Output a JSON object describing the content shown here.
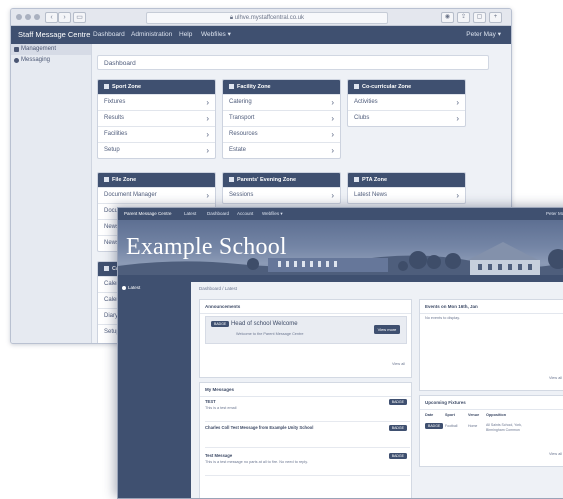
{
  "browser": {
    "url": "ulhve.mystaffcentral.co.uk"
  },
  "back_app": {
    "brand": "Staff Message Centre",
    "nav": [
      "Dashboard",
      "Administration",
      "Help",
      "Webfiles ▾"
    ],
    "user": "Peter May ▾",
    "sidebar": [
      {
        "label": "Management",
        "icon": "management-icon"
      },
      {
        "label": "Messaging",
        "icon": "messaging-icon"
      }
    ],
    "breadcrumb": "Dashboard",
    "zones": [
      {
        "title": "Sport Zone",
        "icon": "sport-icon",
        "items": [
          "Fixtures",
          "Results",
          "Facilities",
          "Setup"
        ]
      },
      {
        "title": "Facility Zone",
        "icon": "facility-icon",
        "items": [
          "Catering",
          "Transport",
          "Resources",
          "Estate"
        ]
      },
      {
        "title": "Co-curricular Zone",
        "icon": "cocurricular-icon",
        "items": [
          "Activities",
          "Clubs"
        ]
      },
      {
        "title": "File Zone",
        "icon": "file-icon",
        "items": [
          "Document Manager",
          "Docum",
          "Newsle",
          "Newsle"
        ]
      },
      {
        "title": "Parents' Evening Zone",
        "icon": "parents-evening-icon",
        "items": [
          "Sessions"
        ]
      },
      {
        "title": "PTA Zone",
        "icon": "pta-icon",
        "items": [
          "Latest News"
        ]
      },
      {
        "title": "Cal",
        "icon": "calendar-icon",
        "items": [
          "Calend",
          "Calend",
          "Diary",
          "Setup"
        ]
      }
    ]
  },
  "front_app": {
    "brand": "Parent Message Centre",
    "nav": [
      "Latest",
      "Dashboard",
      "Account",
      "Webfiles ▾"
    ],
    "user": "Peter May",
    "hero_title": "Example School",
    "sidebar": [
      {
        "label": "Latest",
        "icon": "latest-icon"
      }
    ],
    "breadcrumb": "Dashboard / Latest",
    "announcements": {
      "heading": "Announcements",
      "badge": "BADGE",
      "title": "Head of school Welcome",
      "subtitle": "Welcome to the Parent Message Centre",
      "button": "View more",
      "view_all": "View all"
    },
    "messages": {
      "heading": "My Messages",
      "items": [
        {
          "title": "TEST",
          "sub": "This is a test email",
          "badge": "BADGE"
        },
        {
          "title": "Charles Coll Test Message from Example Unity School",
          "sub": "",
          "badge": "BADGE"
        },
        {
          "title": "Test Message",
          "sub": "This is a test message no parts at all to fire. No need to reply.",
          "badge": "BADGE"
        }
      ]
    },
    "events": {
      "heading": "Events on Mon 16th, Jan",
      "empty": "No events to display.",
      "view_all": "View all"
    },
    "fixtures": {
      "heading": "Upcoming Fixtures",
      "columns": [
        "Date",
        "Sport",
        "Venue",
        "Opposition"
      ],
      "rows": [
        {
          "date": "BADGE",
          "sport": "Football",
          "venue": "Home",
          "opposition": "All Saints School, York, Birmingham Common"
        }
      ],
      "view_all": "View all"
    }
  }
}
